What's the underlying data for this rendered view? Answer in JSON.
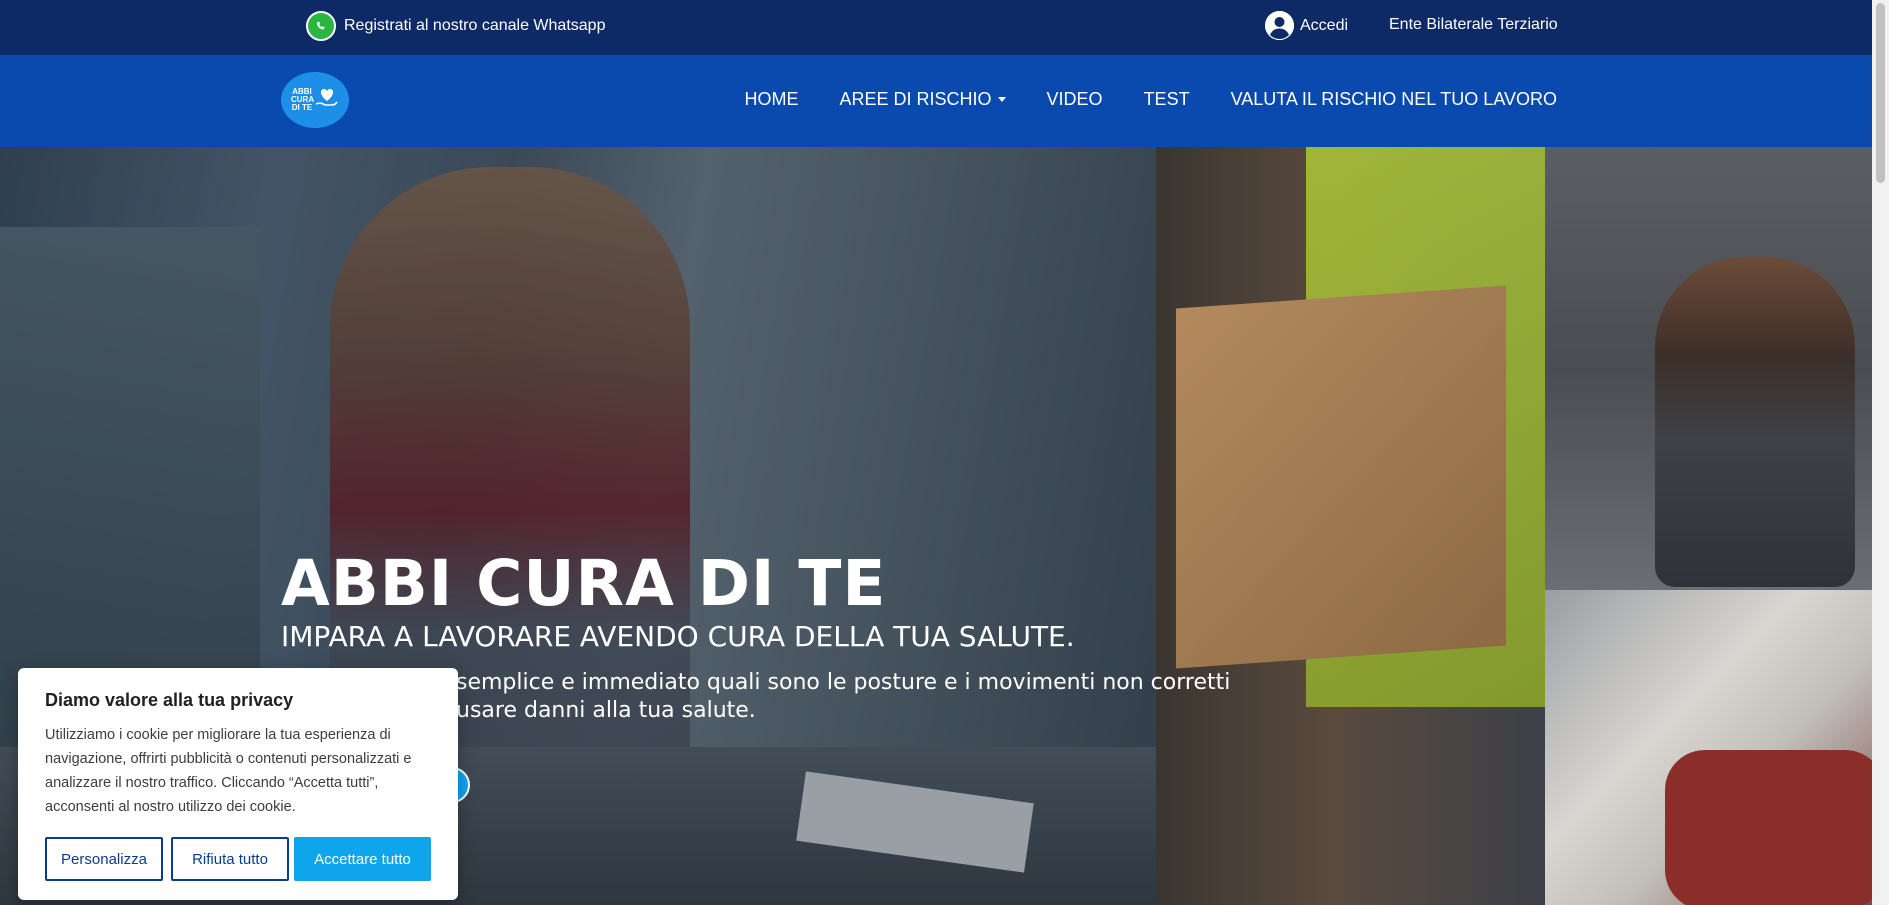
{
  "topbar": {
    "whatsapp_label": "Registrati al nostro canale Whatsapp",
    "login_label": "Accedi",
    "ente_label": "Ente Bilaterale Terziario"
  },
  "logo": {
    "line1": "ABBI",
    "line2": "CURA",
    "line3": "DI TE"
  },
  "nav": {
    "home": "HOME",
    "aree": "AREE DI RISCHIO",
    "video": "VIDEO",
    "test": "TEST",
    "valuta": "VALUTA IL RISCHIO NEL TUO LAVORO"
  },
  "hero": {
    "title": "ABBI CURA DI TE",
    "subtitle": "IMPARA A LAVORARE AVENDO CURA DELLA TUA SALUTE.",
    "description": "semplice e immediato quali sono le posture e i movimenti non corretti usare danni alla tua salute."
  },
  "cookie": {
    "title": "Diamo valore alla tua privacy",
    "text": "Utilizziamo i cookie per migliorare la tua esperienza di navigazione, offrirti pubblicità o contenuti personalizzati e analizzare il nostro traffico. Cliccando “Accetta tutti”, acconsenti al nostro utilizzo dei cookie.",
    "customize_label": "Personalizza",
    "reject_label": "Rifiuta tutto",
    "accept_label": "Accettare tutto"
  },
  "colors": {
    "topbar": "#0d2a66",
    "navbar": "#0a49ad",
    "accent": "#0ea5ec",
    "whatsapp": "#2bb541"
  },
  "icons": [
    "whatsapp-icon",
    "user-icon",
    "heart-hand-icon",
    "chevron-down-icon"
  ]
}
